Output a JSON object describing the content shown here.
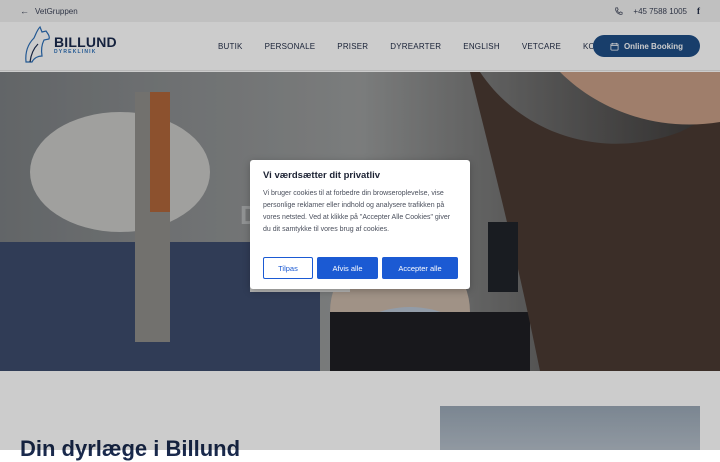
{
  "topbar": {
    "back_label": "VetGruppen",
    "back_icon": "arrow-left-icon",
    "phone": "+45 7588 1005",
    "phone_icon": "phone-icon",
    "social_icon": "facebook-icon"
  },
  "header": {
    "logo": {
      "name": "BILLUND",
      "sub": "DYREKLINIK"
    },
    "nav": [
      "BUTIK",
      "PERSONALE",
      "PRISER",
      "DYREARTER",
      "ENGLISH",
      "VETCARE",
      "KONTAKT"
    ],
    "booking": {
      "label": "Online Booking",
      "icon": "calendar-icon"
    }
  },
  "hero": {
    "title_visible": "D                    d"
  },
  "below": {
    "heading": "Din dyrlæge i Billund"
  },
  "cookie": {
    "title": "Vi værdsætter dit privatliv",
    "body": "Vi bruger cookies til at forbedre din browseroplevelse, vise personlige reklamer eller indhold og analysere trafikken på vores netsted. Ved at klikke på \"Accepter Alle Cookies\" giver du dit samtykke til vores brug af cookies.",
    "customize": "Tilpas",
    "reject": "Afvis alle",
    "accept": "Accepter alle"
  },
  "colors": {
    "brand_navy": "#1e4e86",
    "consent_blue": "#1b5ad3",
    "logo_blue": "#2b6fb8"
  }
}
